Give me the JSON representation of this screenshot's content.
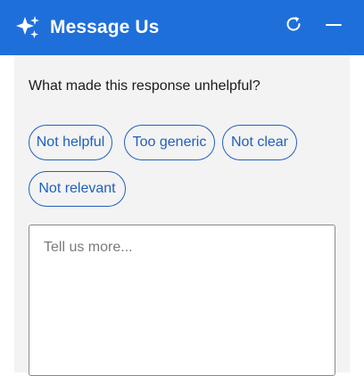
{
  "header": {
    "title": "Message Us",
    "icons": {
      "left": "sparkle-icon",
      "refresh": "refresh-icon",
      "minimize": "minimize-icon"
    },
    "background": "#1f6fdb"
  },
  "feedback": {
    "question": "What made this response unhelpful?",
    "options": [
      "Not helpful",
      "Too generic",
      "Not clear",
      "Not relevant"
    ],
    "details_placeholder": "Tell us more..."
  },
  "colors": {
    "accent": "#1f5fbf",
    "panel": "#f3f3f3"
  }
}
